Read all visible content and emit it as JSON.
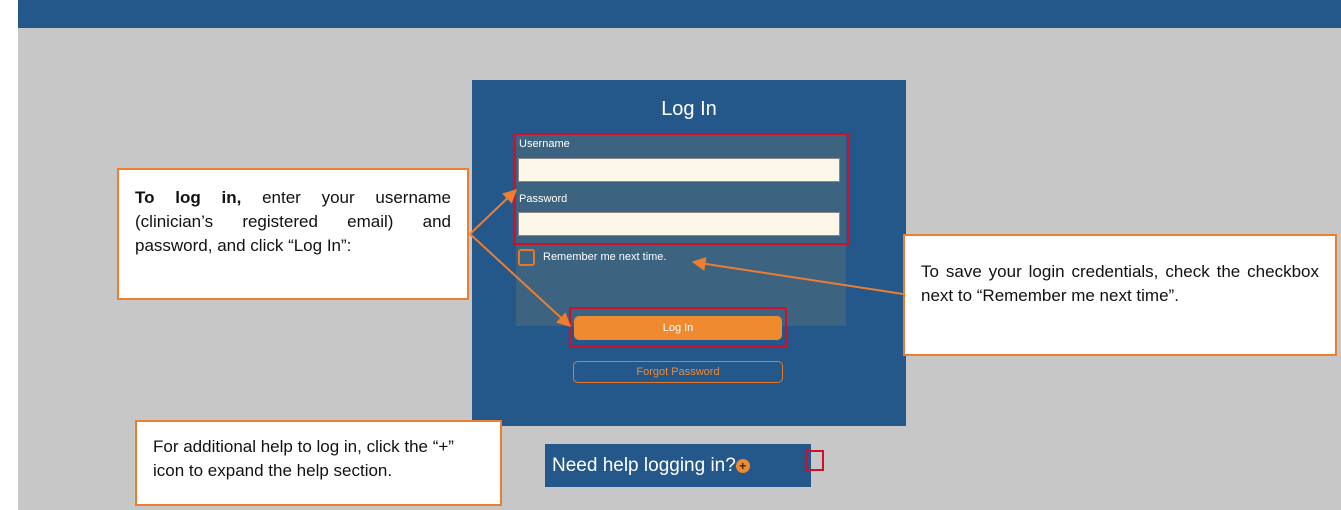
{
  "login": {
    "title": "Log In",
    "username_label": "Username",
    "username_value": "",
    "password_label": "Password",
    "password_value": "",
    "remember_label": "Remember me next time.",
    "login_button": "Log In",
    "forgot_button": "Forgot Password"
  },
  "help": {
    "label": "Need help logging in?",
    "icon": "plus-circle-icon",
    "icon_glyph": "+"
  },
  "callouts": {
    "login_bold": "To log in,",
    "login_rest": " enter your username (clinician’s registered email) and password, and click “Log In”:",
    "remember_text": "To save your login credentials, check the checkbox next to “Remember me next time”.",
    "help_text": "For additional help to log in, click the “+” icon to expand the help section."
  },
  "colors": {
    "panel_blue": "#25588a",
    "accent_orange": "#f08a31",
    "highlight_red": "#d0102a",
    "background_gray": "#c7c7c7"
  }
}
